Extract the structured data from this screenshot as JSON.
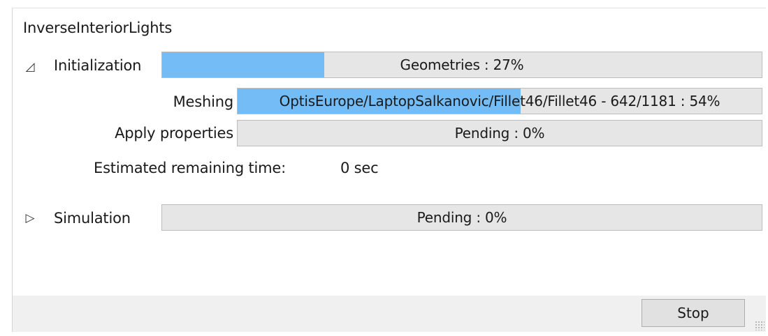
{
  "window": {
    "title": "InverseInteriorLights"
  },
  "initialization": {
    "toggle_icon": "expanded-triangle-icon",
    "toggle_glyph": "◿",
    "label": "Initialization",
    "progress": {
      "text": "Geometries : 27%",
      "percent": 27
    },
    "meshing": {
      "label": "Meshing",
      "progress": {
        "text": "OptisEurope/LaptopSalkanovic/Fillet46/Fillet46 - 642/1181 : 54%",
        "percent": 54
      }
    },
    "apply_properties": {
      "label": "Apply properties",
      "progress": {
        "text": "Pending : 0%",
        "percent": 0
      }
    },
    "estimated": {
      "label": "Estimated remaining time:",
      "value": "0 sec"
    }
  },
  "simulation": {
    "toggle_icon": "collapsed-triangle-icon",
    "toggle_glyph": "▷",
    "label": "Simulation",
    "progress": {
      "text": "Pending : 0%",
      "percent": 0
    }
  },
  "footer": {
    "stop_label": "Stop"
  },
  "colors": {
    "progress_fill": "#73bcf5",
    "track": "#e6e6e6"
  }
}
